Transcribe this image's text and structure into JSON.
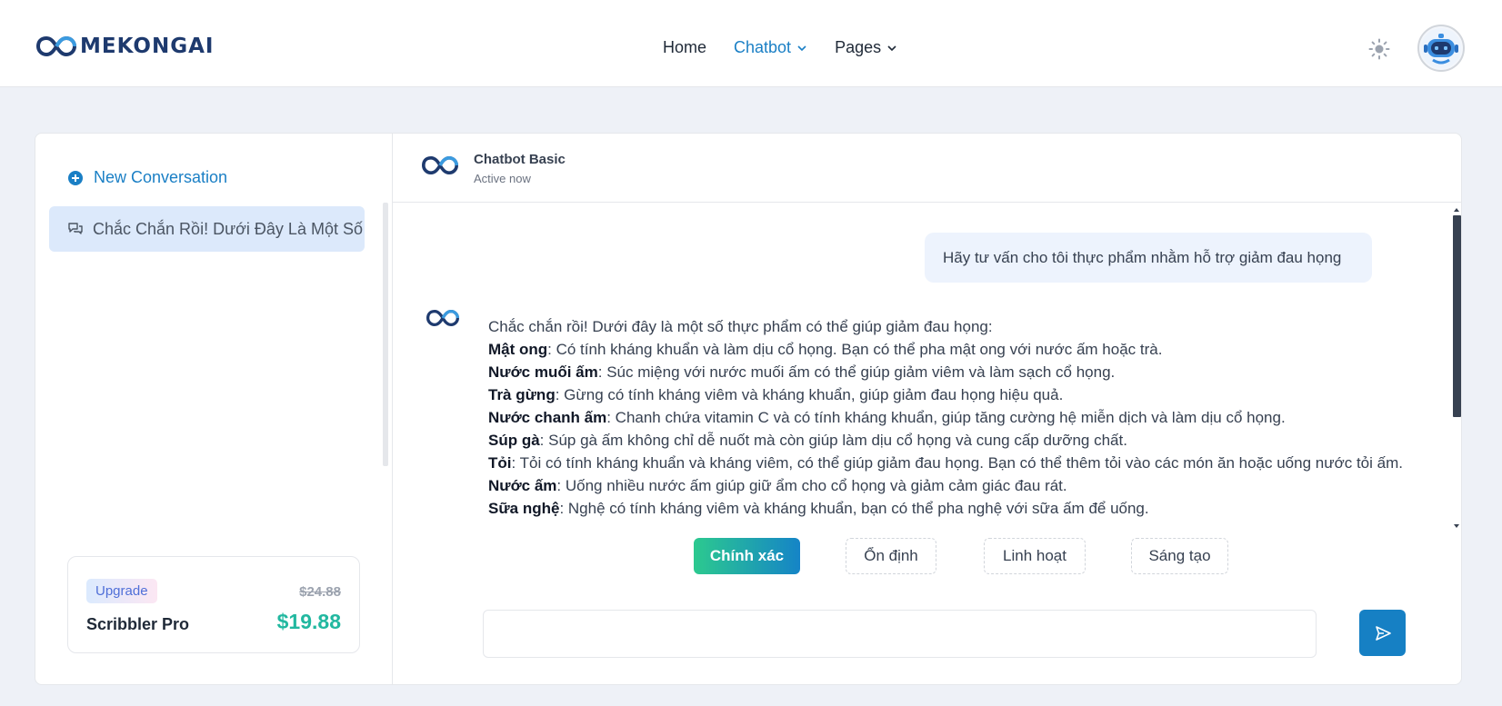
{
  "brand": {
    "name": "MEKONGAI"
  },
  "nav": {
    "home": "Home",
    "chatbot": "Chatbot",
    "pages": "Pages"
  },
  "sidebar": {
    "new_conversation": "New Conversation",
    "conversations": [
      {
        "title": "Chắc Chắn Rồi! Dưới Đây Là Một Số"
      }
    ],
    "upgrade": {
      "badge": "Upgrade",
      "old_price": "$24.88",
      "plan": "Scribbler Pro",
      "price": "$19.88"
    }
  },
  "chat": {
    "bot_name": "Chatbot Basic",
    "status": "Active now",
    "user_message": "Hãy tư vấn cho tôi thực phẩm nhằm hỗ trợ giảm đau họng",
    "bot_intro": "Chắc chắn rồi! Dưới đây là một số thực phẩm có thể giúp giảm đau họng:",
    "bot_items": [
      {
        "term": "Mật ong",
        "text": ": Có tính kháng khuẩn và làm dịu cổ họng. Bạn có thể pha mật ong với nước ấm hoặc trà."
      },
      {
        "term": "Nước muối ấm",
        "text": ": Súc miệng với nước muối ấm có thể giúp giảm viêm và làm sạch cổ họng."
      },
      {
        "term": "Trà gừng",
        "text": ": Gừng có tính kháng viêm và kháng khuẩn, giúp giảm đau họng hiệu quả."
      },
      {
        "term": "Nước chanh ấm",
        "text": ": Chanh chứa vitamin C và có tính kháng khuẩn, giúp tăng cường hệ miễn dịch và làm dịu cổ họng."
      },
      {
        "term": "Súp gà",
        "text": ": Súp gà ấm không chỉ dễ nuốt mà còn giúp làm dịu cổ họng và cung cấp dưỡng chất."
      },
      {
        "term": "Tỏi",
        "text": ": Tỏi có tính kháng khuẩn và kháng viêm, có thể giúp giảm đau họng. Bạn có thể thêm tỏi vào các món ăn hoặc uống nước tỏi ấm."
      },
      {
        "term": "Nước ấm",
        "text": ": Uống nhiều nước ấm giúp giữ ẩm cho cổ họng và giảm cảm giác đau rát."
      },
      {
        "term": "Sữa nghệ",
        "text": ": Nghệ có tính kháng viêm và kháng khuẩn, bạn có thể pha nghệ với sữa ấm để uống."
      }
    ],
    "modes": [
      "Chính xác",
      "Ổn định",
      "Linh hoạt",
      "Sáng tạo"
    ],
    "active_mode": "Chính xác",
    "input_value": ""
  },
  "colors": {
    "accent": "#1a7fc5",
    "price": "#22b8a0",
    "send": "#1680c4"
  }
}
